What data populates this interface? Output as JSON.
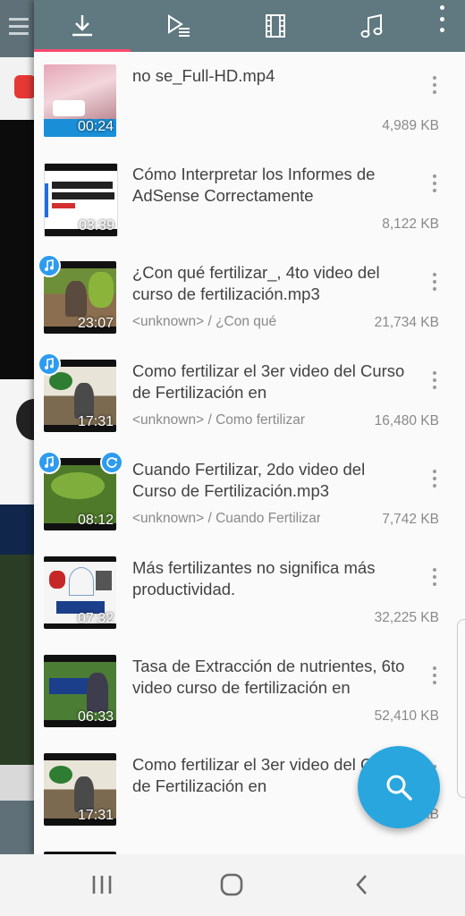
{
  "toolbar": {
    "tabs": [
      {
        "id": "downloads",
        "icon": "download-icon",
        "selected": true
      },
      {
        "id": "playlist",
        "icon": "playlist-icon",
        "selected": false
      },
      {
        "id": "video",
        "icon": "film-icon",
        "selected": false
      },
      {
        "id": "music",
        "icon": "music-note-icon",
        "selected": false
      }
    ],
    "accent_color": "#ff4a6e",
    "bar_color": "#607880"
  },
  "files": [
    {
      "title": "no se_Full-HD.mp4",
      "subtitle": "",
      "size": "4,989 KB",
      "duration": "00:24",
      "music_badge": false,
      "sync_badge": false
    },
    {
      "title": "Cómo Interpretar los Informes de AdSense Correctamente",
      "subtitle": "",
      "size": "8,122 KB",
      "duration": "03:39",
      "music_badge": false,
      "sync_badge": false
    },
    {
      "title": "¿Con qué fertilizar_, 4to video del curso de fertilización.mp3",
      "subtitle": "<unknown> / ¿Con qué",
      "size": "21,734 KB",
      "duration": "23:07",
      "music_badge": true,
      "sync_badge": false
    },
    {
      "title": "Como fertilizar el 3er video del Curso de Fertilización en",
      "subtitle": "<unknown> / Como fertilizar",
      "size": "16,480 KB",
      "duration": "17:31",
      "music_badge": true,
      "sync_badge": false
    },
    {
      "title": "Cuando Fertilizar, 2do video del Curso de Fertilización.mp3",
      "subtitle": "<unknown> / Cuando Fertilizar,",
      "size": "7,742 KB",
      "duration": "08:12",
      "music_badge": true,
      "sync_badge": true
    },
    {
      "title": "Más fertilizantes no significa más productividad.",
      "subtitle": "",
      "size": "32,225 KB",
      "duration": "07:32",
      "music_badge": false,
      "sync_badge": false
    },
    {
      "title": "Tasa de Extracción de nutrientes, 6to video curso de fertilización en",
      "subtitle": "",
      "size": "52,410 KB",
      "duration": "06:33",
      "music_badge": false,
      "sync_badge": false
    },
    {
      "title": "Como fertilizar el 3er video del Curso de Fertilización en",
      "subtitle": "",
      "size": "KB",
      "duration": "17:31",
      "music_badge": false,
      "sync_badge": false
    }
  ],
  "fab": {
    "icon": "search-icon",
    "color": "#2aa6df"
  },
  "navbar": {
    "buttons": [
      "recent-apps-icon",
      "home-icon",
      "back-icon"
    ]
  }
}
